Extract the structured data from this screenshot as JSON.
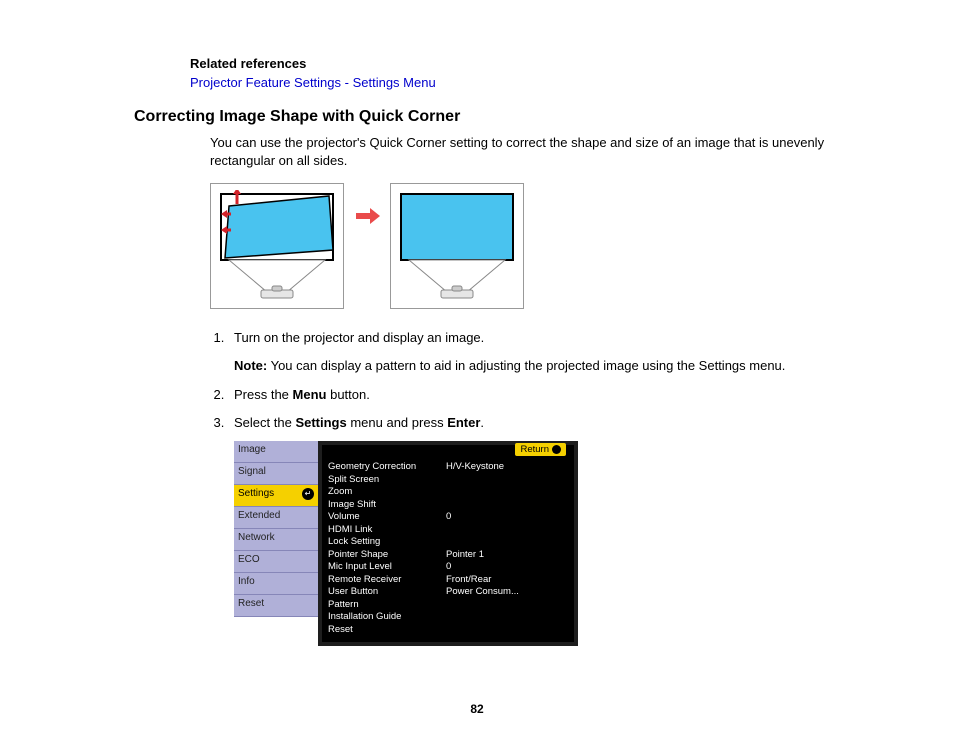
{
  "refs": {
    "heading": "Related references",
    "link": "Projector Feature Settings - Settings Menu"
  },
  "title": "Correcting Image Shape with Quick Corner",
  "intro": "You can use the projector's Quick Corner setting to correct the shape and size of an image that is unevenly rectangular on all sides.",
  "steps": {
    "s1": "Turn on the projector and display an image.",
    "note_prefix": "Note:",
    "note_body": " You can display a pattern to aid in adjusting the projected image using the Settings menu.",
    "s2_pre": "Press the ",
    "s2_bold": "Menu",
    "s2_post": " button.",
    "s3_pre": "Select the ",
    "s3_bold1": "Settings",
    "s3_mid": " menu and press ",
    "s3_bold2": "Enter",
    "s3_post": "."
  },
  "nav": {
    "n0": "Image",
    "n1": "Signal",
    "n2": "Settings",
    "n3": "Extended",
    "n4": "Network",
    "n5": "ECO",
    "n6": "Info",
    "n7": "Reset"
  },
  "panel": {
    "return": "Return",
    "rows": [
      {
        "lbl": "Geometry Correction",
        "val": "H/V-Keystone"
      },
      {
        "lbl": "Split Screen",
        "val": ""
      },
      {
        "lbl": "Zoom",
        "val": ""
      },
      {
        "lbl": "Image Shift",
        "val": ""
      },
      {
        "lbl": "Volume",
        "val": "0"
      },
      {
        "lbl": "HDMI Link",
        "val": ""
      },
      {
        "lbl": "Lock Setting",
        "val": ""
      },
      {
        "lbl": "Pointer Shape",
        "val": "Pointer 1"
      },
      {
        "lbl": "Mic Input Level",
        "val": "0"
      },
      {
        "lbl": "Remote Receiver",
        "val": "Front/Rear"
      },
      {
        "lbl": "User Button",
        "val": "Power Consum..."
      },
      {
        "lbl": "Pattern",
        "val": ""
      },
      {
        "lbl": "Installation Guide",
        "val": ""
      },
      {
        "lbl": "Reset",
        "val": ""
      }
    ]
  },
  "page_number": "82"
}
